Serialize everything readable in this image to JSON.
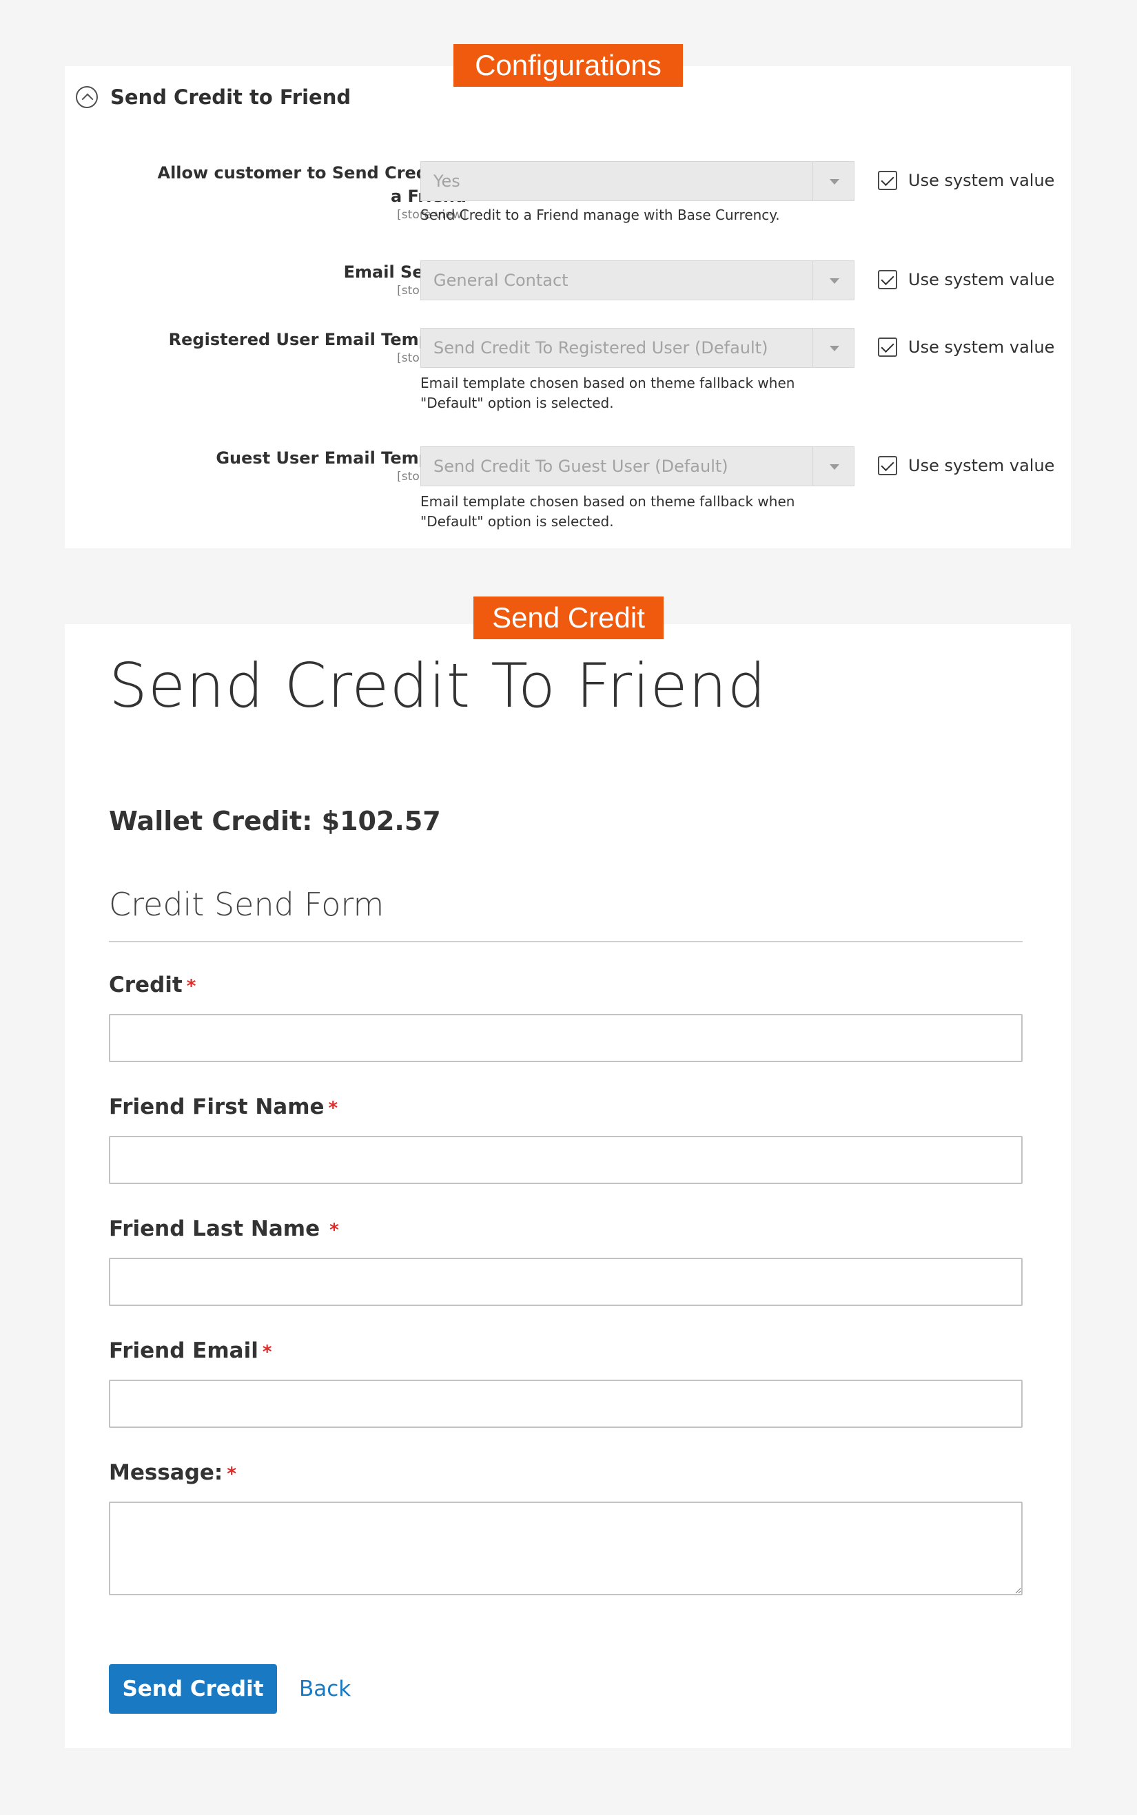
{
  "tags": {
    "configurations": "Configurations",
    "send_credit": "Send Credit"
  },
  "config": {
    "section_title": "Send Credit to Friend",
    "section_icon": "collapse-circle-icon",
    "rows": [
      {
        "label": "Allow customer to Send Credit to a Friend",
        "scope": "[store view]",
        "value": "Yes",
        "note": "Send Credit to a Friend manage with Base Currency.",
        "system_label": "Use system value",
        "system_checked": true
      },
      {
        "label": "Email Sender",
        "scope": "[store view]",
        "value": "General Contact",
        "note": "",
        "system_label": "Use system value",
        "system_checked": true
      },
      {
        "label": "Registered User Email Template",
        "scope": "[store view]",
        "value": "Send Credit To Registered User (Default)",
        "note": "Email template chosen based on theme fallback when \"Default\" option is selected.",
        "system_label": "Use system value",
        "system_checked": true
      },
      {
        "label": "Guest User Email Template",
        "scope": "[store view]",
        "value": "Send Credit To Guest User (Default)",
        "note": "Email template chosen based on theme fallback when \"Default\" option is selected.",
        "system_label": "Use system value",
        "system_checked": true
      }
    ]
  },
  "send": {
    "page_title": "Send Credit To Friend",
    "wallet": "Wallet Credit: $102.57",
    "legend": "Credit Send Form",
    "required_mark": "*",
    "fields": {
      "credit": "Credit",
      "first_name": "Friend First Name",
      "last_name": "Friend Last Name",
      "email": "Friend Email",
      "message": "Message:"
    },
    "submit_label": "Send Credit",
    "back_label": "Back"
  },
  "colors": {
    "tag": "#f05a0e",
    "primary": "#1979c3",
    "required": "#e02b27",
    "background": "#f5f5f5"
  }
}
